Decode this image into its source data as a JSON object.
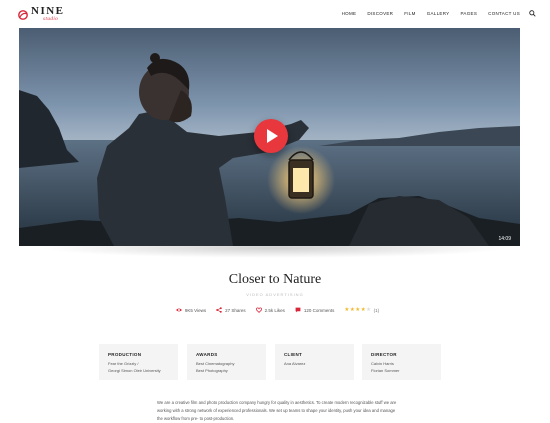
{
  "brand": {
    "name": "NINE",
    "tagline": "studio",
    "accent": "#d9263a"
  },
  "nav": {
    "items": [
      "HOME",
      "DISCOVER",
      "FILM",
      "GALLERY",
      "PAGES",
      "CONTACT US"
    ],
    "search_icon": "search-icon"
  },
  "hero": {
    "duration": "14:09",
    "play_icon": "play-icon",
    "play_color": "#e8373d"
  },
  "project": {
    "title": "Closer to Nature",
    "subtitle": "VIDEO ADVERTISING"
  },
  "stats": {
    "views": "9K5 Views",
    "shares": "27 Shares",
    "likes": "2.5k Likes",
    "comments": "120 Comments",
    "rating": 4,
    "rating_max": 5,
    "rating_count": "(1)"
  },
  "info": [
    {
      "label": "PRODUCTION",
      "lines": [
        "Fear the Grizzly /",
        "Georgi Simon Oleir University"
      ]
    },
    {
      "label": "AWARDS",
      "lines": [
        "Best Cinematography",
        "Best Photography"
      ]
    },
    {
      "label": "CLIENT",
      "lines": [
        "Ana Alvarez"
      ]
    },
    {
      "label": "DIRECTOR",
      "lines": [
        "Calvin Harris",
        "Florian Sommer"
      ]
    }
  ],
  "description": "We are a creative film and photo production company hungry for quality in aesthetics. To create modern recognizable stuff we are working with a strong network of experienced professionals. We set up teams to shape your identity, push your idea and manage the workflow from pre- to post-production."
}
